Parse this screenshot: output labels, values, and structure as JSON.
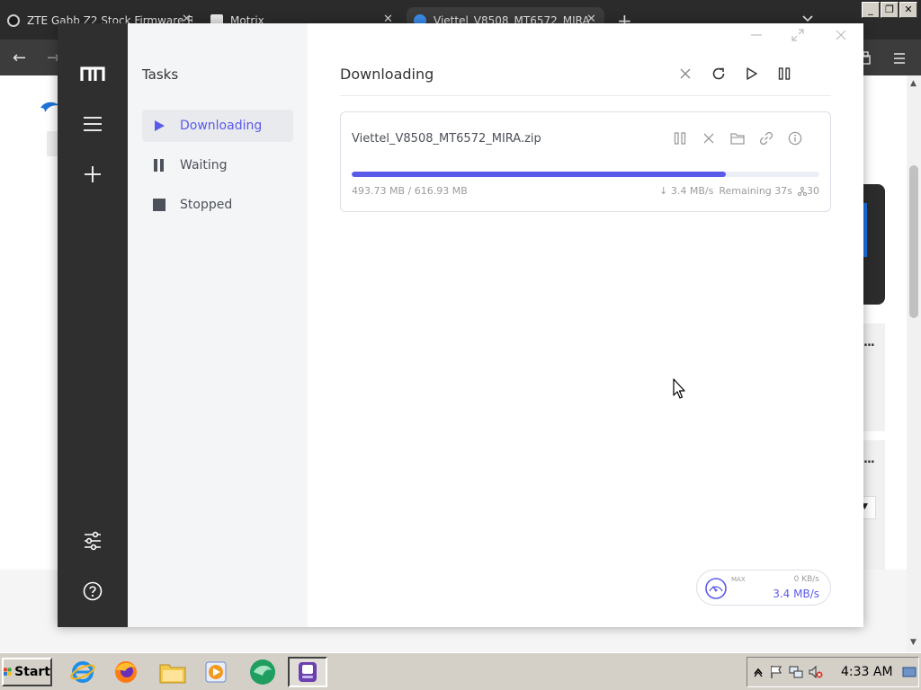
{
  "browser": {
    "tabs": [
      {
        "title": "ZTE Gabb Z2 Stock Firmware R",
        "active": false
      },
      {
        "title": "Motrix",
        "active": false
      },
      {
        "title": "Viettel_V8508_MT6572_MIRA",
        "active": true
      }
    ],
    "new_tab": "+",
    "win_minimize": "_",
    "win_restore": "❐",
    "win_close": "✕",
    "card_dots": "..."
  },
  "motrix": {
    "nav": {
      "title": "Tasks",
      "items": [
        {
          "label": "Downloading",
          "icon": "play-icon",
          "active": true
        },
        {
          "label": "Waiting",
          "icon": "pause-icon",
          "active": false
        },
        {
          "label": "Stopped",
          "icon": "stop-icon",
          "active": false
        }
      ]
    },
    "header": {
      "title": "Downloading"
    },
    "task": {
      "name": "Viettel_V8508_MT6572_MIRA.zip",
      "progress": 0.8,
      "size": "493.73 MB / 616.93 MB",
      "speed": "↓ 3.4 MB/s",
      "remaining": "Remaining 37s",
      "connections": "30"
    },
    "speedometer": {
      "label": "MAX",
      "upload": "0 KB/s",
      "download": "3.4 MB/s"
    },
    "accent_color": "#5b5bea"
  },
  "taskbar": {
    "start_label": "Start",
    "clock": "4:33 AM"
  }
}
